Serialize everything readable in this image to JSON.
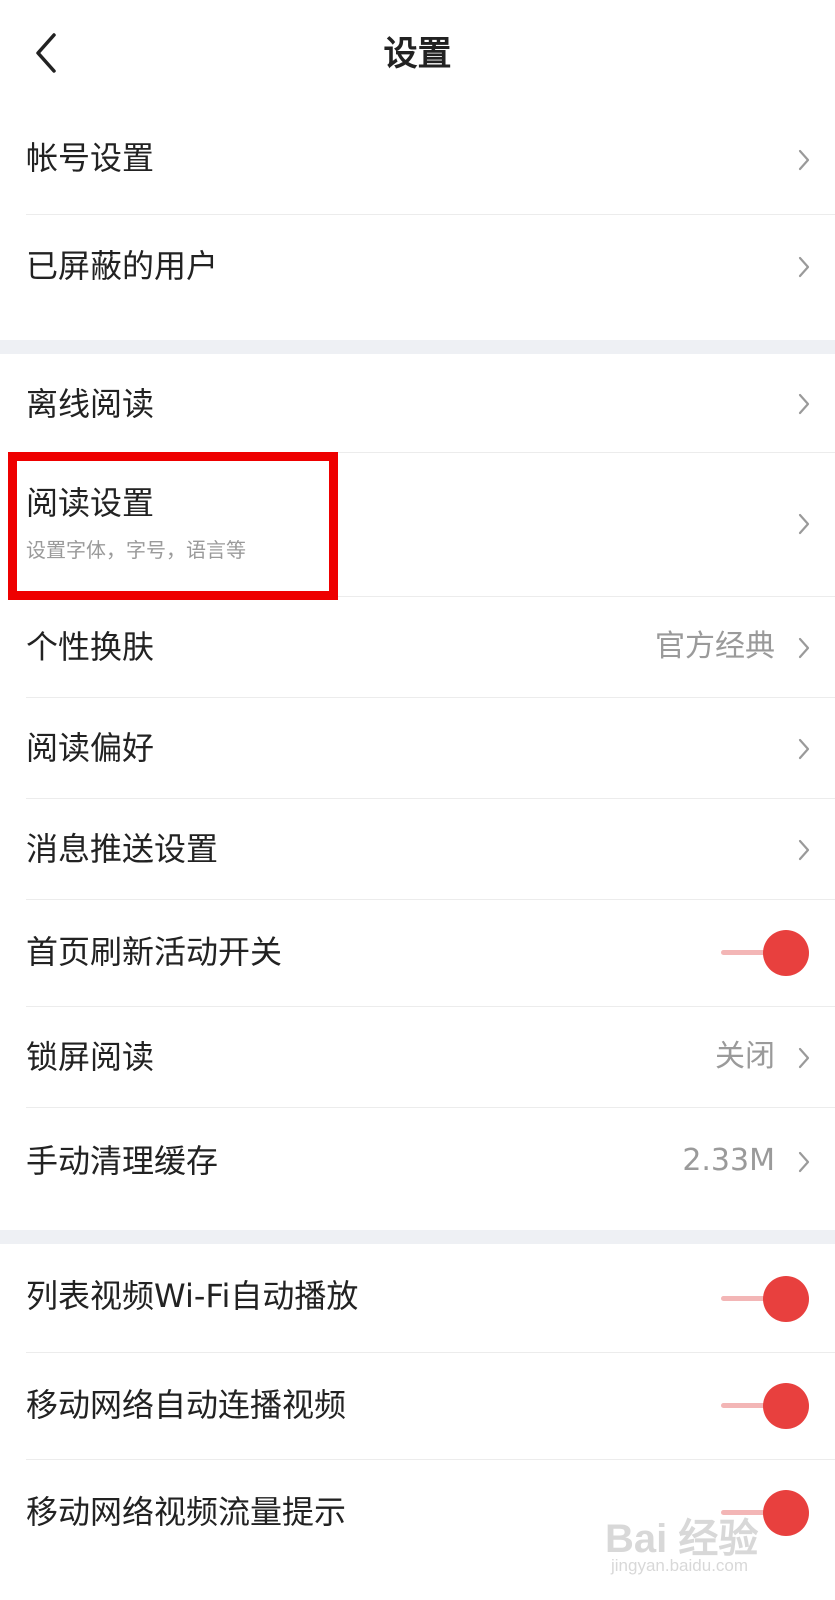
{
  "header": {
    "back_icon": "chevron-left-icon",
    "title": "设置"
  },
  "section1": {
    "items": [
      {
        "label": "帐号设置"
      },
      {
        "label": "已屏蔽的用户"
      }
    ]
  },
  "section2": {
    "items": [
      {
        "label": "离线阅读"
      },
      {
        "label": "阅读设置",
        "sublabel": "设置字体，字号，语言等"
      },
      {
        "label": "个性换肤",
        "value": "官方经典"
      },
      {
        "label": "阅读偏好"
      },
      {
        "label": "消息推送设置"
      },
      {
        "label": "首页刷新活动开关",
        "toggle": true
      },
      {
        "label": "锁屏阅读",
        "value": "关闭"
      },
      {
        "label": "手动清理缓存",
        "value": "2.33M"
      }
    ]
  },
  "section3": {
    "items": [
      {
        "label": "列表视频Wi-Fi自动播放",
        "toggle": true
      },
      {
        "label": "移动网络自动连播视频",
        "toggle": true
      },
      {
        "label": "移动网络视频流量提示",
        "toggle": true
      }
    ]
  },
  "colors": {
    "accent": "#e8403e",
    "track": "#f3b6b6",
    "section_gap": "#eef0f4",
    "highlight": "#ee0000"
  },
  "watermark": {
    "brand": "Bai 经验",
    "sub": "jingyan.baidu.com"
  }
}
